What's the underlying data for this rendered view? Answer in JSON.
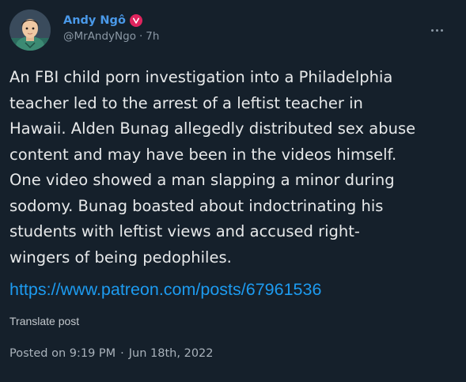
{
  "author": {
    "display_name": "Andy Ngô",
    "handle": "@MrAndyNgo",
    "separator": "·",
    "time_ago": "7h"
  },
  "post": {
    "text": "An FBI child porn investigation into a Philadelphia\nteacher led to the arrest of a leftist teacher in\nHawaii. Alden Bunag allegedly distributed sex abuse\ncontent and may have been in the videos himself.\nOne video showed a man slapping a minor during\nsodomy. Bunag boasted about indoctrinating his\nstudents with leftist views and accused right-\nwingers of being pedophiles.",
    "link": "https://www.patreon.com/posts/67961536",
    "translate_label": "Translate post",
    "posted_on_label": "Posted on 9:19 PM",
    "posted_separator": "·",
    "posted_date": "Jun 18th, 2022"
  },
  "icons": {
    "badge": "verified-badge-icon",
    "more": "more-options-icon"
  },
  "colors": {
    "background": "#15202b",
    "text": "#e7e9ea",
    "muted": "#8b98a5",
    "link": "#1d9bf0",
    "author": "#4a99e9",
    "badge": "#e0245e"
  }
}
